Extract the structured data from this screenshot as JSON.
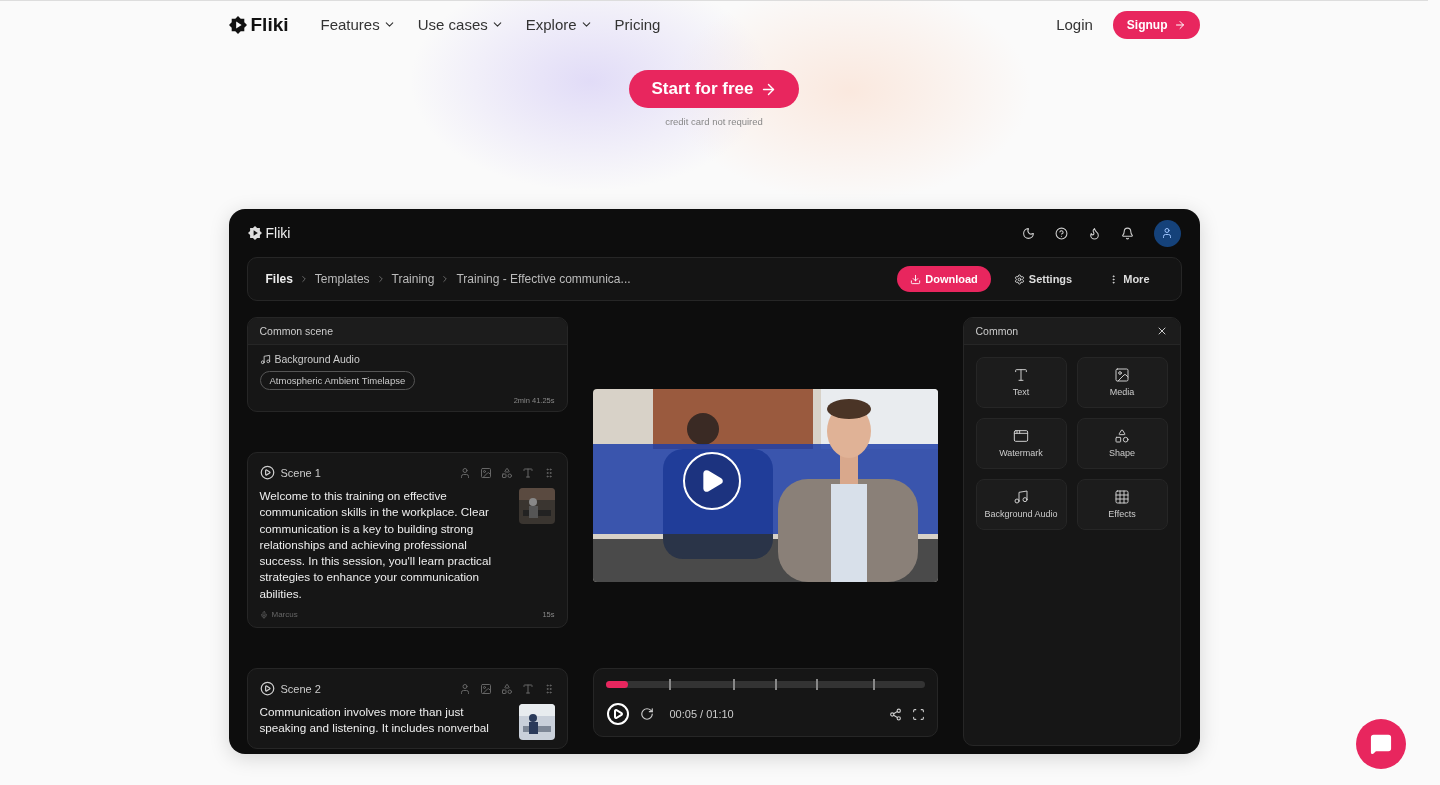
{
  "nav": {
    "logo": "Fliki",
    "links": [
      {
        "label": "Features",
        "dropdown": true
      },
      {
        "label": "Use cases",
        "dropdown": true
      },
      {
        "label": "Explore",
        "dropdown": true
      },
      {
        "label": "Pricing",
        "dropdown": false
      }
    ],
    "login": "Login",
    "signup": "Signup"
  },
  "hero": {
    "cta": "Start for free",
    "note": "credit card not required"
  },
  "app": {
    "logo": "Fliki",
    "breadcrumbs": [
      "Files",
      "Templates",
      "Training",
      "Training - Effective communica..."
    ],
    "actions": [
      {
        "label": "Download",
        "kind": "primary"
      },
      {
        "label": "Settings",
        "kind": "settings"
      },
      {
        "label": "More",
        "kind": "more"
      }
    ],
    "common_scene": {
      "title": "Common scene",
      "audio_label": "Background Audio",
      "track": "Atmospheric Ambient Timelapse",
      "duration": "2min 41.25s"
    },
    "scenes": [
      {
        "title": "Scene 1",
        "text": "Welcome to this training on effective communication skills in the workplace. Clear communication is a key to building strong relationships and achieving professional success. In this session, you'll learn practical strategies to enhance your communication abilities.",
        "voice": "Marcus",
        "duration": "15s"
      },
      {
        "title": "Scene 2",
        "text": "Communication involves more than just speaking and listening. It includes nonverbal"
      }
    ],
    "player": {
      "level": 0.07,
      "time": "00:05 / 01:10"
    },
    "panel": {
      "title": "Common",
      "tools": [
        {
          "label": "Text",
          "kind": "text"
        },
        {
          "label": "Media",
          "kind": "media"
        },
        {
          "label": "Watermark",
          "kind": "watermark"
        },
        {
          "label": "Shape",
          "kind": "shape"
        },
        {
          "label": "Background Audio",
          "kind": "audio"
        },
        {
          "label": "Effects",
          "kind": "effects"
        }
      ]
    }
  }
}
